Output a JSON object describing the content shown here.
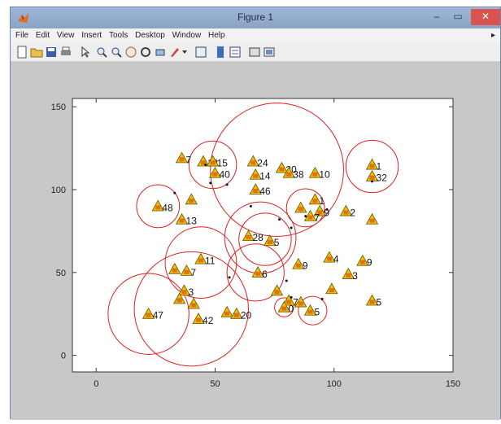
{
  "window": {
    "title": "Figure 1",
    "close": "✕",
    "min": "–",
    "max": "▭"
  },
  "menu": [
    "File",
    "Edit",
    "View",
    "Insert",
    "Tools",
    "Desktop",
    "Window",
    "Help"
  ],
  "toolbar_icons": [
    "new-figure-icon",
    "open-file-icon",
    "save-icon",
    "print-icon",
    "pointer-icon",
    "zoom-in-icon",
    "zoom-out-icon",
    "pan-icon",
    "rotate-3d-icon",
    "data-cursor-icon",
    "brush-icon",
    "brush-dropdown-icon",
    "link-plot-icon",
    "colorbar-icon",
    "legend-icon",
    "hide-tools-icon",
    "show-tools-icon"
  ],
  "chart_data": {
    "type": "scatter",
    "xlim": [
      -10,
      150
    ],
    "ylim": [
      -10,
      155
    ],
    "xticks": [
      0,
      50,
      100,
      150
    ],
    "yticks": [
      0,
      50,
      100,
      150
    ],
    "grid": false,
    "points": [
      {
        "x": 36,
        "y": 119,
        "label": "7"
      },
      {
        "x": 45,
        "y": 117,
        "label": "18"
      },
      {
        "x": 49,
        "y": 117,
        "label": "15"
      },
      {
        "x": 50,
        "y": 110,
        "label": "40"
      },
      {
        "x": 66,
        "y": 117,
        "label": "24"
      },
      {
        "x": 67,
        "y": 109,
        "label": "14"
      },
      {
        "x": 67,
        "y": 100,
        "label": "46"
      },
      {
        "x": 78,
        "y": 113,
        "label": "30"
      },
      {
        "x": 81,
        "y": 110,
        "label": "38"
      },
      {
        "x": 92,
        "y": 110,
        "label": "10"
      },
      {
        "x": 116,
        "y": 115,
        "label": "1"
      },
      {
        "x": 116,
        "y": 108,
        "label": "32"
      },
      {
        "x": 40,
        "y": 94,
        "label": ""
      },
      {
        "x": 26,
        "y": 90,
        "label": "48"
      },
      {
        "x": 36,
        "y": 82,
        "label": "13"
      },
      {
        "x": 92,
        "y": 94,
        "label": "1"
      },
      {
        "x": 86,
        "y": 89,
        "label": ""
      },
      {
        "x": 94,
        "y": 87,
        "label": "9"
      },
      {
        "x": 90,
        "y": 84,
        "label": "7"
      },
      {
        "x": 105,
        "y": 87,
        "label": "2"
      },
      {
        "x": 116,
        "y": 82,
        "label": ""
      },
      {
        "x": 64,
        "y": 72,
        "label": "28"
      },
      {
        "x": 73,
        "y": 69,
        "label": "5"
      },
      {
        "x": 44,
        "y": 58,
        "label": "11"
      },
      {
        "x": 33,
        "y": 52,
        "label": ""
      },
      {
        "x": 38,
        "y": 51,
        "label": "7"
      },
      {
        "x": 68,
        "y": 50,
        "label": "6"
      },
      {
        "x": 85,
        "y": 55,
        "label": "9"
      },
      {
        "x": 98,
        "y": 59,
        "label": "4"
      },
      {
        "x": 112,
        "y": 57,
        "label": "9"
      },
      {
        "x": 106,
        "y": 49,
        "label": "3"
      },
      {
        "x": 37,
        "y": 39,
        "label": "3"
      },
      {
        "x": 35,
        "y": 34,
        "label": ""
      },
      {
        "x": 41,
        "y": 31,
        "label": ""
      },
      {
        "x": 76,
        "y": 39,
        "label": ""
      },
      {
        "x": 81,
        "y": 33,
        "label": "7"
      },
      {
        "x": 86,
        "y": 32,
        "label": ""
      },
      {
        "x": 99,
        "y": 40,
        "label": ""
      },
      {
        "x": 116,
        "y": 33,
        "label": "5"
      },
      {
        "x": 79,
        "y": 29,
        "label": "0"
      },
      {
        "x": 90,
        "y": 27,
        "label": "5"
      },
      {
        "x": 22,
        "y": 25,
        "label": "47"
      },
      {
        "x": 43,
        "y": 22,
        "label": "42"
      },
      {
        "x": 55,
        "y": 26,
        "label": ""
      },
      {
        "x": 59,
        "y": 25,
        "label": "20"
      }
    ],
    "markers": [
      {
        "x": 33,
        "y": 98
      },
      {
        "x": 48,
        "y": 104
      },
      {
        "x": 55,
        "y": 103
      },
      {
        "x": 65,
        "y": 90
      },
      {
        "x": 77,
        "y": 82
      },
      {
        "x": 82,
        "y": 77
      },
      {
        "x": 88,
        "y": 84
      },
      {
        "x": 97,
        "y": 88
      },
      {
        "x": 116,
        "y": 105
      },
      {
        "x": 56,
        "y": 47
      },
      {
        "x": 80,
        "y": 45
      },
      {
        "x": 95,
        "y": 34
      },
      {
        "x": 82,
        "y": 35
      },
      {
        "x": 46,
        "y": 115
      }
    ],
    "circles": [
      {
        "x": 76,
        "y": 112,
        "r": 28
      },
      {
        "x": 49,
        "y": 115,
        "r": 10
      },
      {
        "x": 116,
        "y": 114,
        "r": 11
      },
      {
        "x": 26,
        "y": 90,
        "r": 9
      },
      {
        "x": 88,
        "y": 89,
        "r": 8
      },
      {
        "x": 69,
        "y": 71,
        "r": 15
      },
      {
        "x": 71,
        "y": 70,
        "r": 11
      },
      {
        "x": 44,
        "y": 56,
        "r": 15
      },
      {
        "x": 67,
        "y": 50,
        "r": 12
      },
      {
        "x": 40,
        "y": 28,
        "r": 24
      },
      {
        "x": 22,
        "y": 25,
        "r": 17
      },
      {
        "x": 79,
        "y": 29,
        "r": 4
      },
      {
        "x": 91,
        "y": 27,
        "r": 6
      }
    ]
  }
}
